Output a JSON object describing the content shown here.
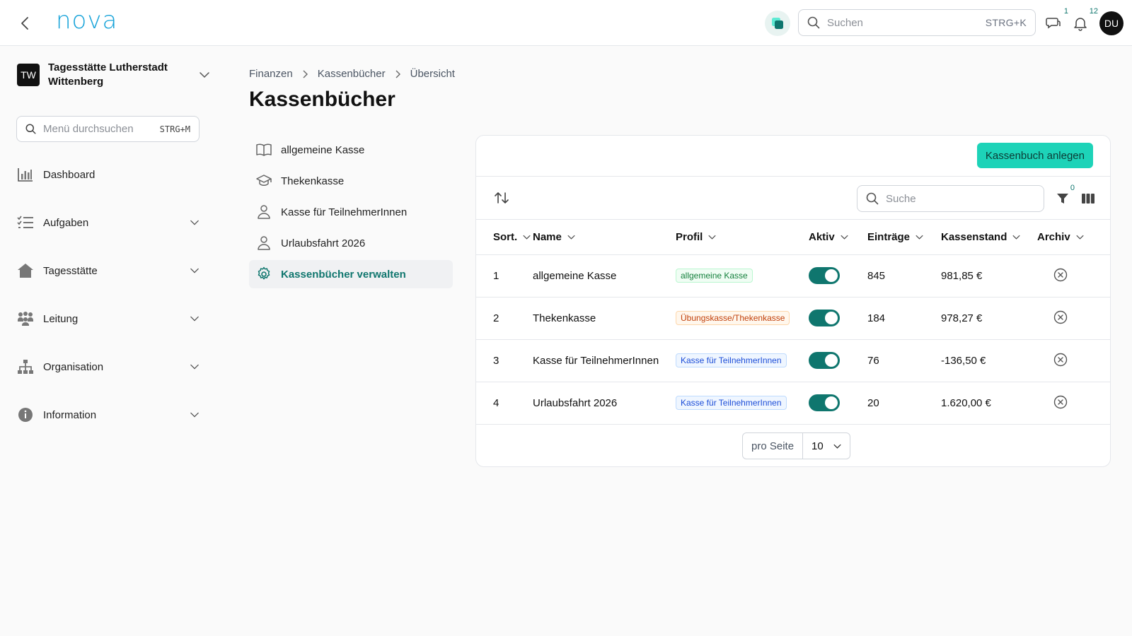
{
  "header": {
    "logo": "nova",
    "search_placeholder": "Suchen",
    "search_shortcut": "STRG+K",
    "messages_count": "1",
    "notifications_count": "12",
    "avatar_initials": "DU"
  },
  "sidebar": {
    "org_initials": "TW",
    "org_name": "Tagesstätte Lutherstadt Wittenberg",
    "menu_search_placeholder": "Menü durchsuchen",
    "menu_search_shortcut": "STRG+M",
    "items": [
      {
        "label": "Dashboard",
        "icon": "chart-bar-icon"
      },
      {
        "label": "Aufgaben",
        "icon": "task-list-icon"
      },
      {
        "label": "Tagesstätte",
        "icon": "home-icon"
      },
      {
        "label": "Leitung",
        "icon": "users-group-icon"
      },
      {
        "label": "Organisation",
        "icon": "org-chart-icon"
      },
      {
        "label": "Information",
        "icon": "info-icon"
      }
    ]
  },
  "breadcrumb": [
    "Finanzen",
    "Kassenbücher",
    "Übersicht"
  ],
  "page_title": "Kassenbücher",
  "sublist": [
    {
      "label": "allgemeine Kasse",
      "icon": "book-icon"
    },
    {
      "label": "Thekenkasse",
      "icon": "graduation-cap-icon"
    },
    {
      "label": "Kasse für TeilnehmerInnen",
      "icon": "user-icon"
    },
    {
      "label": "Urlaubsfahrt 2026",
      "icon": "user-icon"
    },
    {
      "label": "Kassenbücher verwalten",
      "icon": "gear-icon",
      "active": true
    }
  ],
  "table": {
    "create_button": "Kassenbuch anlegen",
    "search_placeholder": "Suche",
    "filter_count": "0",
    "columns": [
      "Sort.",
      "Name",
      "Profil",
      "Aktiv",
      "Einträge",
      "Kassenstand",
      "Archiv"
    ],
    "rows": [
      {
        "sort": "1",
        "name": "allgemeine Kasse",
        "profil": "allgemeine Kasse",
        "profil_color": "green",
        "aktiv": true,
        "eintraege": "845",
        "kassenstand": "981,85 €"
      },
      {
        "sort": "2",
        "name": "Thekenkasse",
        "profil": "Übungskasse/Thekenkasse",
        "profil_color": "orange",
        "aktiv": true,
        "eintraege": "184",
        "kassenstand": "978,27 €"
      },
      {
        "sort": "3",
        "name": "Kasse für TeilnehmerInnen",
        "profil": "Kasse für TeilnehmerInnen",
        "profil_color": "blue",
        "aktiv": true,
        "eintraege": "76",
        "kassenstand": "-136,50 €"
      },
      {
        "sort": "4",
        "name": "Urlaubsfahrt 2026",
        "profil": "Kasse für TeilnehmerInnen",
        "profil_color": "blue",
        "aktiv": true,
        "eintraege": "20",
        "kassenstand": "1.620,00 €"
      }
    ],
    "per_page_label": "pro Seite",
    "per_page_value": "10"
  },
  "colors": {
    "accent": "#0f766e",
    "button": "#1dd3b8",
    "logo": "#17a3d9"
  }
}
